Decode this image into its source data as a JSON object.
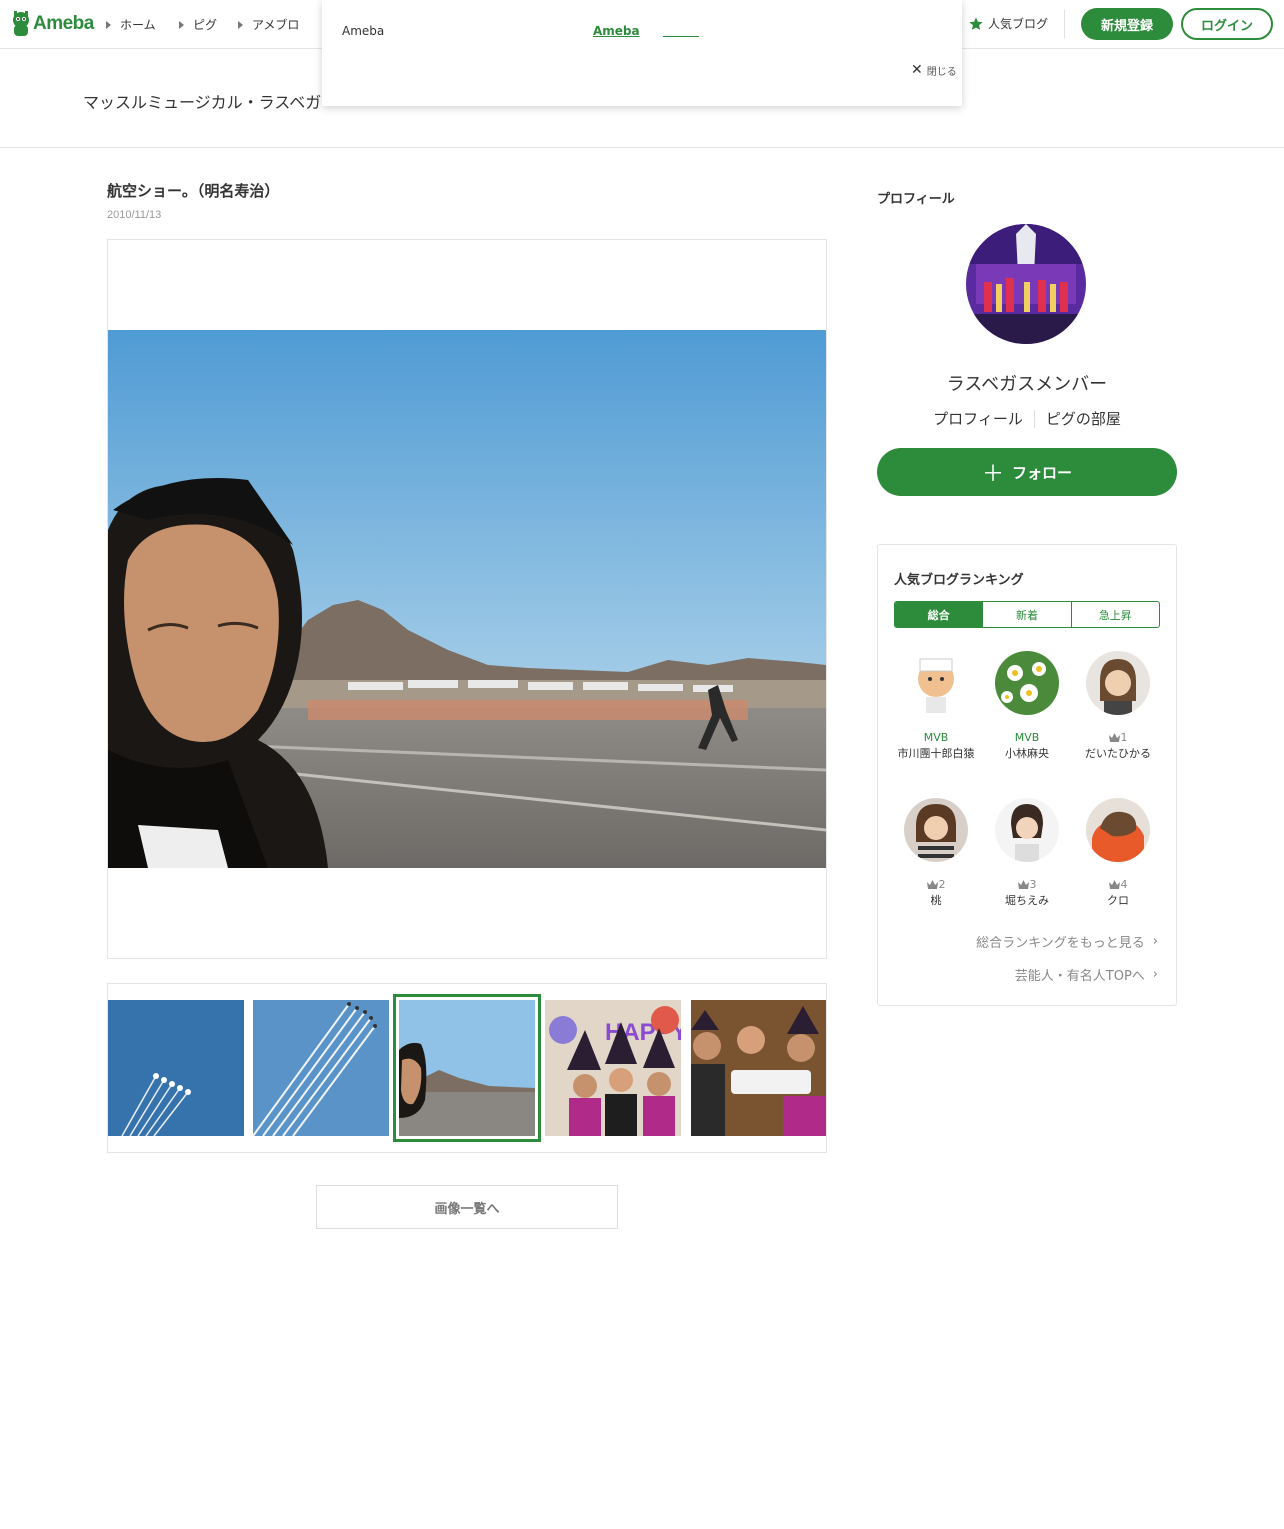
{
  "header": {
    "logo_text": "Ameba",
    "nav": [
      {
        "label": "ホーム"
      },
      {
        "label": "ピグ"
      },
      {
        "label": "アメブロ"
      }
    ],
    "popular_label": "人気ブログ",
    "register_label": "新規登録",
    "login_label": "ログイン"
  },
  "notice": {
    "text": "Ameba",
    "link": "Ameba",
    "close_label": "閉じる"
  },
  "blog": {
    "title": "マッスルミュージカル・ラスベガ"
  },
  "post": {
    "title": "航空ショー。（明名寿治）",
    "date": "2010/11/13"
  },
  "images_button": "画像一覧へ",
  "sidebar": {
    "heading": "プロフィール",
    "name": "ラスベガスメンバー",
    "link_profile": "プロフィール",
    "link_pig": "ピグの部屋",
    "follow_label": "フォロー"
  },
  "ranking": {
    "title": "人気ブログランキング",
    "tabs": [
      "総合",
      "新着",
      "急上昇"
    ],
    "items": [
      {
        "label": "MVB",
        "name": "市川團十郎白猿"
      },
      {
        "label": "MVB",
        "name": "小林麻央"
      },
      {
        "label": "1",
        "name": "だいたひかる"
      },
      {
        "label": "2",
        "name": "桃"
      },
      {
        "label": "3",
        "name": "堀ちえみ"
      },
      {
        "label": "4",
        "name": "クロ"
      }
    ],
    "more_overall": "総合ランキングをもっと見る",
    "more_celebs": "芸能人・有名人TOPへ"
  },
  "colors": {
    "brand_green": "#2d8c3c"
  }
}
